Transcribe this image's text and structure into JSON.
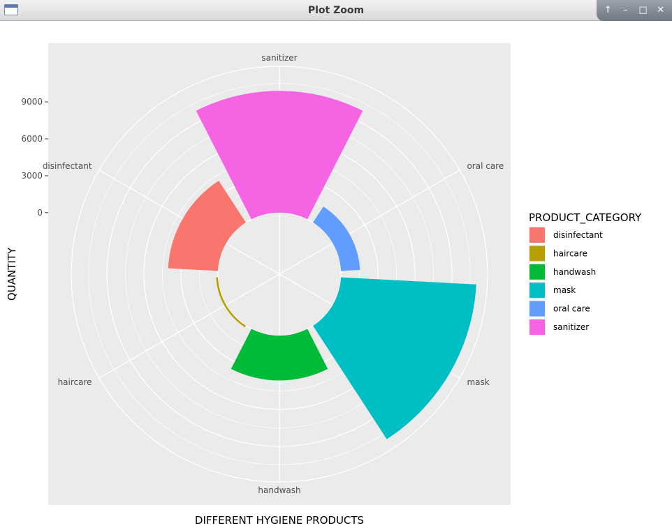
{
  "window": {
    "title": "Plot Zoom",
    "controls": [
      "↑",
      "–",
      "□",
      "✕"
    ]
  },
  "chart_data": {
    "type": "polar-bar",
    "xlabel": "DIFFERENT HYGIENE PRODUCTS",
    "ylabel": "QUANTITY",
    "categories": [
      "sanitizer",
      "oral care",
      "mask",
      "handwash",
      "haircare",
      "disinfectant"
    ],
    "values": [
      9900,
      1550,
      11000,
      3650,
      150,
      4050
    ],
    "yticks": [
      0,
      3000,
      6000,
      9000
    ],
    "ylim": [
      -5000,
      11900
    ],
    "legend": {
      "title": "PRODUCT_CATEGORY",
      "position": "right",
      "items": [
        "disinfectant",
        "haircare",
        "handwash",
        "mask",
        "oral care",
        "sanitizer"
      ]
    },
    "colors": {
      "disinfectant": "#F8766D",
      "haircare": "#B79F00",
      "handwash": "#00BA38",
      "mask": "#00BFC4",
      "oral care": "#619CFF",
      "sanitizer": "#F564E3"
    },
    "panel_background": "#EBEBEB",
    "grid": true
  }
}
